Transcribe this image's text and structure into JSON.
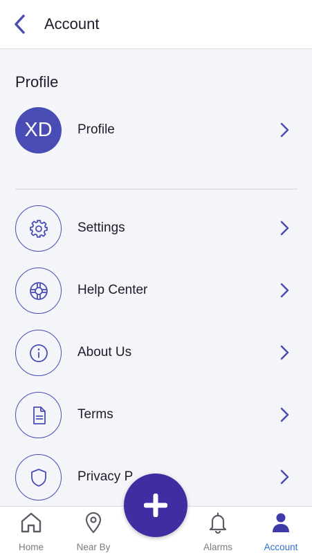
{
  "header": {
    "title": "Account",
    "back_icon": "chevron-left-icon"
  },
  "profile_section": {
    "title": "Profile",
    "avatar_initials": "XD",
    "label": "Profile"
  },
  "menu": [
    {
      "label": "Settings",
      "icon": "gear-icon"
    },
    {
      "label": "Help Center",
      "icon": "lifebuoy-icon"
    },
    {
      "label": "About Us",
      "icon": "info-icon"
    },
    {
      "label": "Terms",
      "icon": "document-icon"
    },
    {
      "label": "Privacy P",
      "icon": "shield-icon"
    }
  ],
  "tabbar": {
    "tabs": [
      {
        "label": "Home",
        "icon": "home-icon"
      },
      {
        "label": "Near By",
        "icon": "location-pin-icon"
      },
      {
        "label": "Alarms",
        "icon": "bell-icon"
      },
      {
        "label": "Account",
        "icon": "user-icon",
        "active": true
      }
    ],
    "fab_icon": "plus-icon"
  },
  "colors": {
    "accent": "#4a4cb5",
    "fab": "#3e2ea2",
    "active_tab": "#2f6fd0",
    "background": "#f4f5f9"
  }
}
